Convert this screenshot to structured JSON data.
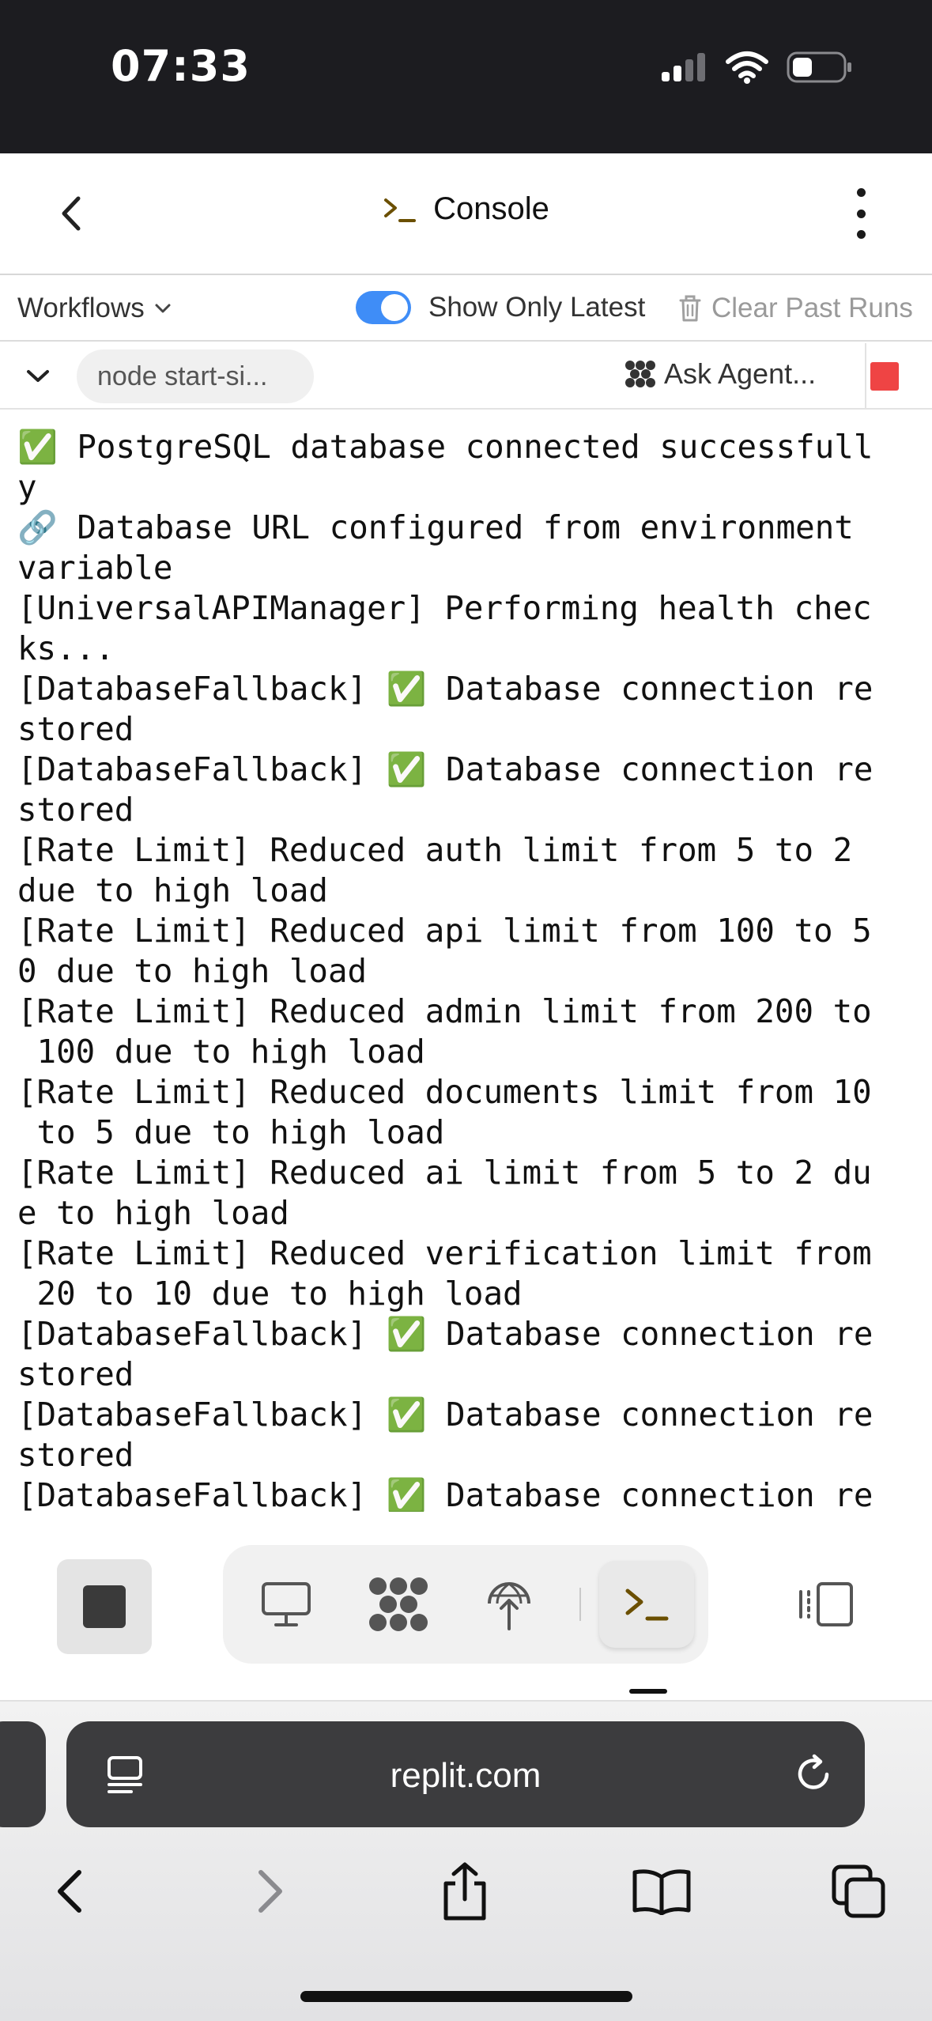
{
  "status_bar": {
    "time": "07:33"
  },
  "header": {
    "title": "Console"
  },
  "toolbar": {
    "workflows_label": "Workflows",
    "show_only_latest_label": "Show Only Latest",
    "show_only_latest_enabled": true,
    "clear_past_runs_label": "Clear Past Runs"
  },
  "process": {
    "name": "node start-si...",
    "ask_agent_label": "Ask Agent..."
  },
  "console": {
    "lines": [
      "✅ PostgreSQL database connected successfull",
      "y",
      "🔗 Database URL configured from environment",
      "variable",
      "[UniversalAPIManager] Performing health chec",
      "ks...",
      "[DatabaseFallback] ✅ Database connection re",
      "stored",
      "[DatabaseFallback] ✅ Database connection re",
      "stored",
      "[Rate Limit] Reduced auth limit from 5 to 2",
      "due to high load",
      "[Rate Limit] Reduced api limit from 100 to 5",
      "0 due to high load",
      "[Rate Limit] Reduced admin limit from 200 to",
      " 100 due to high load",
      "[Rate Limit] Reduced documents limit from 10",
      " to 5 due to high load",
      "[Rate Limit] Reduced ai limit from 5 to 2 du",
      "e to high load",
      "[Rate Limit] Reduced verification limit from",
      " 20 to 10 due to high load",
      "[DatabaseFallback] ✅ Database connection re",
      "stored",
      "[DatabaseFallback] ✅ Database connection re",
      "stored",
      "[DatabaseFallback] ✅ Database connection re"
    ]
  },
  "browser": {
    "url": "replit.com"
  },
  "colors": {
    "status_bar_bg": "#1c1c20",
    "toggle_on": "#3f8df7",
    "stop_red": "#ef4444",
    "url_bar_bg": "#3c3c3e"
  },
  "icons": {
    "back": "chevron-left-icon",
    "console": "terminal-prompt-icon",
    "menu": "kebab-icon",
    "clear": "trash-icon",
    "agent": "agent-icon",
    "preview": "monitor-icon",
    "deploy": "globe-upload-icon",
    "reload": "reload-icon",
    "share": "share-icon",
    "bookmarks": "book-icon",
    "tabs": "tabs-icon"
  }
}
